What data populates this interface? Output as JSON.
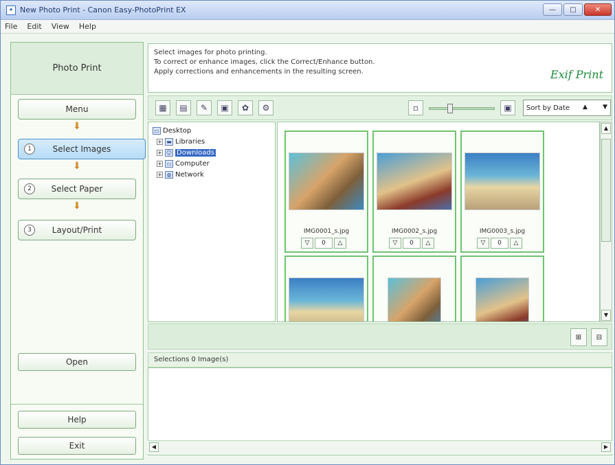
{
  "window": {
    "title": "New Photo Print - Canon Easy-PhotoPrint EX",
    "minimize": "—",
    "maximize": "□",
    "close": "✕"
  },
  "menu": [
    "File",
    "Edit",
    "View",
    "Help"
  ],
  "left": {
    "header": "Photo Print",
    "steps": [
      {
        "label": "Menu",
        "num": ""
      },
      {
        "label": "Select Images",
        "num": "1"
      },
      {
        "label": "Select Paper",
        "num": "2"
      },
      {
        "label": "Layout/Print",
        "num": "3"
      }
    ],
    "open_label": "Open",
    "help_label": "Help",
    "exit_label": "Exit"
  },
  "instructions": {
    "line1": "Select images for photo printing.",
    "line2": "To correct or enhance images, click the Correct/Enhance button.",
    "line3": "Apply corrections and enhancements in the resulting screen.",
    "logo": "Exif Print"
  },
  "toolbar": {
    "sort_label": "Sort by Date",
    "sort_dir": "▲",
    "icons": [
      "grid-view-icon",
      "details-icon",
      "correct-enhance-icon",
      "preview-icon",
      "effects-icon",
      "settings-icon"
    ]
  },
  "tree": {
    "root": "Desktop",
    "items": [
      {
        "label": "Libraries",
        "selected": false
      },
      {
        "label": "Downloads",
        "selected": true
      },
      {
        "label": "Computer",
        "selected": false
      },
      {
        "label": "Network",
        "selected": false
      }
    ]
  },
  "thumbnails": [
    {
      "file": "IMG0001_s.jpg",
      "count": "0"
    },
    {
      "file": "IMG0002_s.jpg",
      "count": "0"
    },
    {
      "file": "IMG0003_s.jpg",
      "count": "0"
    },
    {
      "file": "",
      "count": ""
    },
    {
      "file": "",
      "count": ""
    },
    {
      "file": "",
      "count": ""
    }
  ],
  "selection": {
    "header": "Selections 0 Image(s)"
  }
}
